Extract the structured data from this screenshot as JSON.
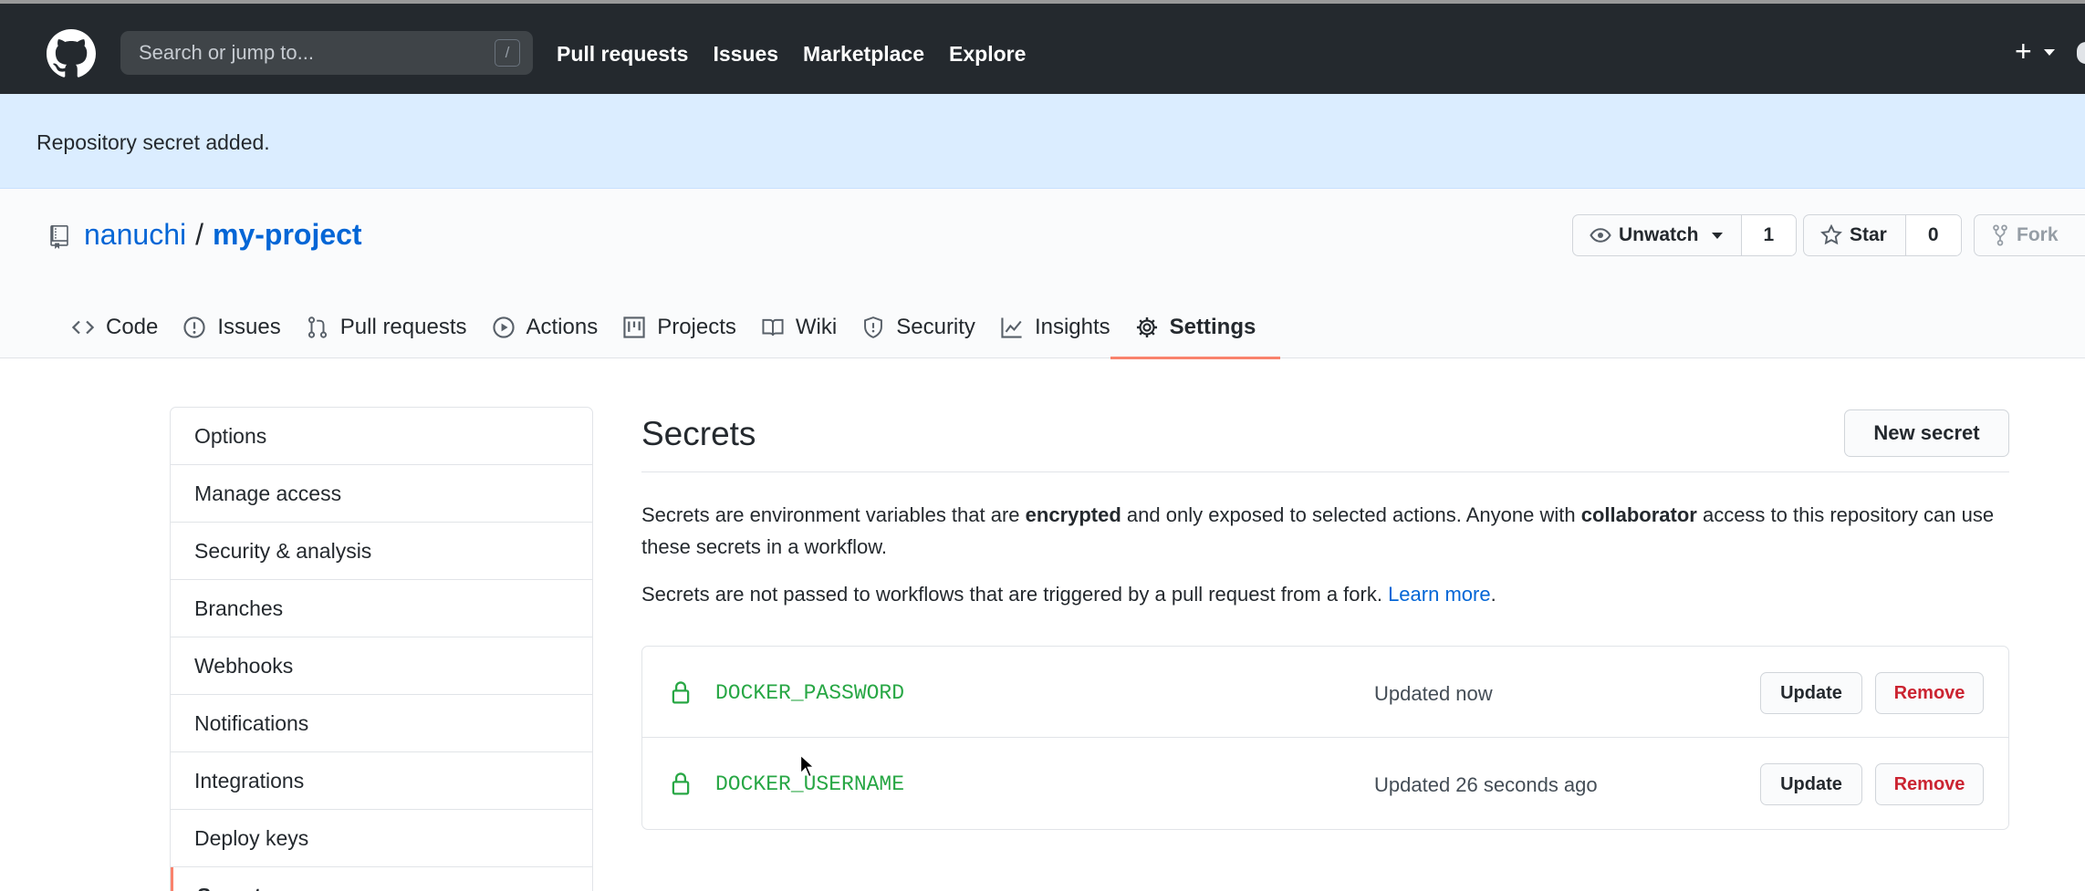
{
  "header": {
    "search_placeholder": "Search or jump to...",
    "search_shortcut": "/",
    "nav": [
      "Pull requests",
      "Issues",
      "Marketplace",
      "Explore"
    ],
    "plus_label": "+"
  },
  "flash": {
    "message": "Repository secret added."
  },
  "repo": {
    "owner": "nanuchi",
    "separator": "/",
    "name": "my-project",
    "watch": {
      "label": "Unwatch",
      "count": "1"
    },
    "star": {
      "label": "Star",
      "count": "0"
    },
    "fork": {
      "label": "Fork"
    }
  },
  "tabs": [
    {
      "label": "Code",
      "icon": "code-icon"
    },
    {
      "label": "Issues",
      "icon": "issue-icon"
    },
    {
      "label": "Pull requests",
      "icon": "pull-request-icon"
    },
    {
      "label": "Actions",
      "icon": "play-icon"
    },
    {
      "label": "Projects",
      "icon": "project-icon"
    },
    {
      "label": "Wiki",
      "icon": "book-icon"
    },
    {
      "label": "Security",
      "icon": "shield-icon"
    },
    {
      "label": "Insights",
      "icon": "graph-icon"
    },
    {
      "label": "Settings",
      "icon": "gear-icon",
      "selected": true
    }
  ],
  "sidebar": {
    "items": [
      {
        "label": "Options"
      },
      {
        "label": "Manage access"
      },
      {
        "label": "Security & analysis"
      },
      {
        "label": "Branches"
      },
      {
        "label": "Webhooks"
      },
      {
        "label": "Notifications"
      },
      {
        "label": "Integrations"
      },
      {
        "label": "Deploy keys"
      },
      {
        "label": "Secrets",
        "active": true
      }
    ]
  },
  "main": {
    "title": "Secrets",
    "new_secret_button": "New secret",
    "description": {
      "part1": "Secrets are environment variables that are ",
      "bold1": "encrypted",
      "part2": " and only exposed to selected actions. Anyone with ",
      "bold2": "collaborator",
      "part3": " access to this repository can use these secrets in a workflow."
    },
    "fork_note": {
      "text": "Secrets are not passed to workflows that are triggered by a pull request from a fork. ",
      "link": "Learn more",
      "end": "."
    },
    "secrets": [
      {
        "name": "DOCKER_PASSWORD",
        "updated": "Updated now",
        "update_label": "Update",
        "remove_label": "Remove"
      },
      {
        "name": "DOCKER_USERNAME",
        "updated": "Updated 26 seconds ago",
        "update_label": "Update",
        "remove_label": "Remove"
      }
    ]
  },
  "colors": {
    "header_bg": "#24292e",
    "flash_bg": "#dbedff",
    "link": "#0366d6",
    "secret_name": "#28a745",
    "danger": "#cb2431",
    "tab_underline": "#f9826c"
  }
}
